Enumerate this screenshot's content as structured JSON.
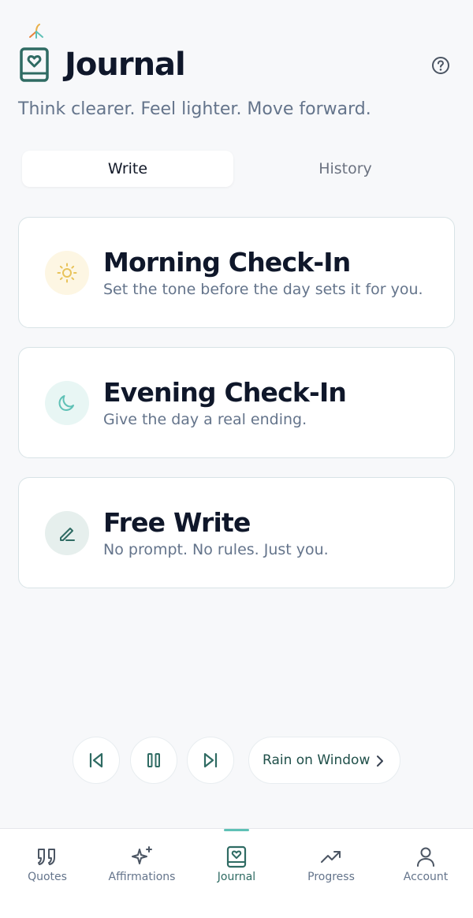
{
  "header": {
    "title": "Journal",
    "subtitle": "Think clearer. Feel lighter. Move forward."
  },
  "tabs": [
    {
      "label": "Write",
      "active": true
    },
    {
      "label": "History",
      "active": false
    }
  ],
  "cards": [
    {
      "title": "Morning Check-In",
      "subtitle": "Set the tone before the day sets it for you.",
      "icon": "sun-icon"
    },
    {
      "title": "Evening Check-In",
      "subtitle": "Give the day a real ending.",
      "icon": "moon-icon"
    },
    {
      "title": "Free Write",
      "subtitle": "No prompt. No rules. Just you.",
      "icon": "pencil-icon"
    }
  ],
  "player": {
    "track_name": "Rain on Window",
    "state": "playing"
  },
  "nav": {
    "items": [
      {
        "label": "Quotes",
        "icon": "quote-icon",
        "active": false
      },
      {
        "label": "Affirmations",
        "icon": "sparkles-icon",
        "active": false
      },
      {
        "label": "Journal",
        "icon": "journal-icon",
        "active": true
      },
      {
        "label": "Progress",
        "icon": "trending-up-icon",
        "active": false
      },
      {
        "label": "Account",
        "icon": "user-icon",
        "active": false
      }
    ]
  },
  "colors": {
    "accent": "#2f6b63",
    "accent_light": "#5fc1b6",
    "sun": "#e8c35a",
    "moon": "#5fc1b6"
  }
}
